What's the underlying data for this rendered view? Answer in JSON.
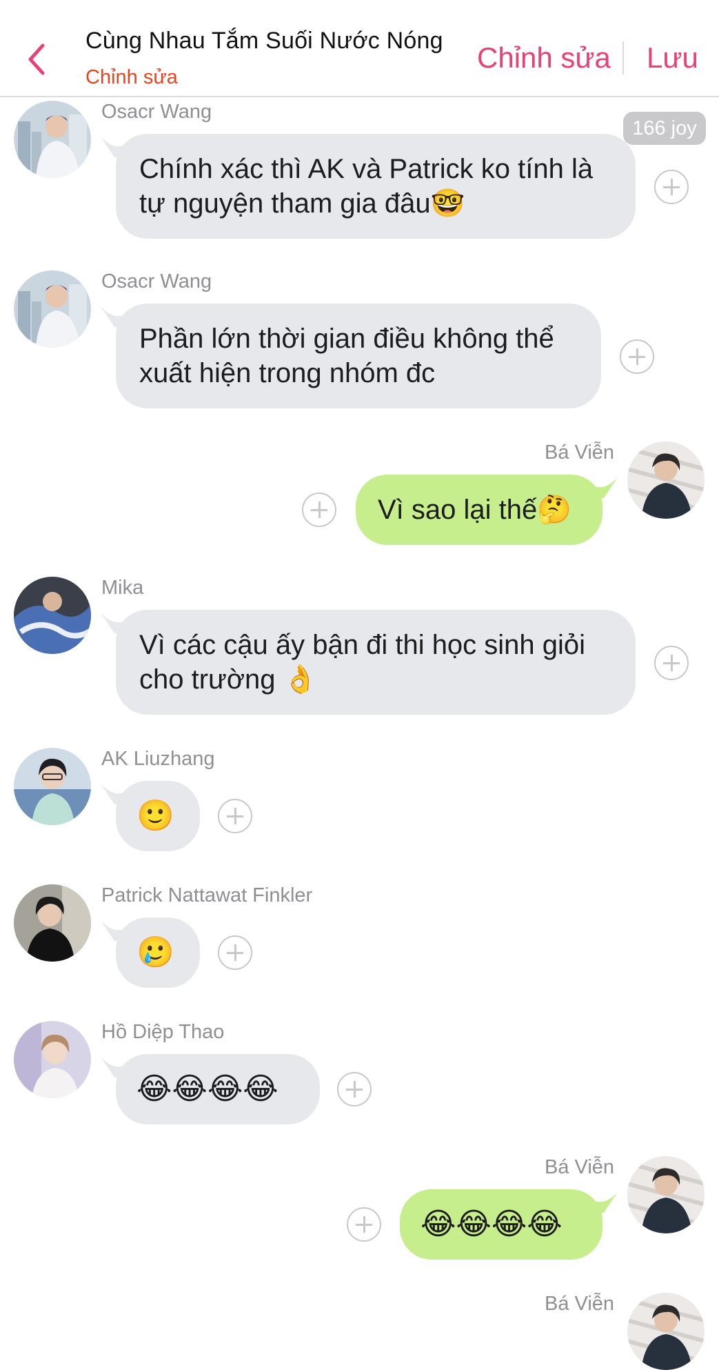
{
  "header": {
    "title": "Cùng Nhau Tắm Suối Nước Nóng",
    "subtitle": "Chỉnh sửa",
    "edit_label": "Chỉnh sửa",
    "save_label": "Lưu",
    "accent_color": "#e84176",
    "subtitle_color": "#e8451e"
  },
  "messages": [
    {
      "sender": "Osacr Wang",
      "text": "Chính xác thì AK và Patrick ko tính là\ntự nguyện tham gia đâu🤓",
      "direction": "incoming",
      "badge": "166 joy",
      "avatar_icon": "person-photo-avatar"
    },
    {
      "sender": "Osacr Wang",
      "text": "Phần lớn thời gian điều không thể\nxuất hiện trong nhóm đc",
      "direction": "incoming",
      "avatar_icon": "person-photo-avatar"
    },
    {
      "sender": "Bá Viễn",
      "text": "Vì sao lại thế🤔",
      "direction": "outgoing",
      "avatar_icon": "person-photo-avatar"
    },
    {
      "sender": "Mika",
      "text": "Vì các cậu ấy bận đi thi học sinh giỏi\ncho trường 👌",
      "direction": "incoming",
      "avatar_icon": "person-photo-avatar"
    },
    {
      "sender": "AK Liuzhang",
      "text": "🙂",
      "direction": "incoming",
      "avatar_icon": "person-photo-avatar"
    },
    {
      "sender": "Patrick Nattawat Finkler",
      "text": "🥲",
      "direction": "incoming",
      "avatar_icon": "person-photo-avatar"
    },
    {
      "sender": "Hồ Diệp Thao",
      "text": "😂😂😂😂",
      "direction": "incoming",
      "avatar_icon": "person-photo-avatar"
    },
    {
      "sender": "Bá Viễn",
      "text": "😂😂😂😂",
      "direction": "outgoing",
      "avatar_icon": "person-photo-avatar"
    },
    {
      "sender": "Bá Viễn",
      "direction": "outgoing",
      "avatar_icon": "person-photo-avatar"
    }
  ],
  "colors": {
    "incoming_bubble": "#e6e8ec",
    "outgoing_bubble": "#c6ee8c",
    "sender_name": "#8e8e93"
  }
}
